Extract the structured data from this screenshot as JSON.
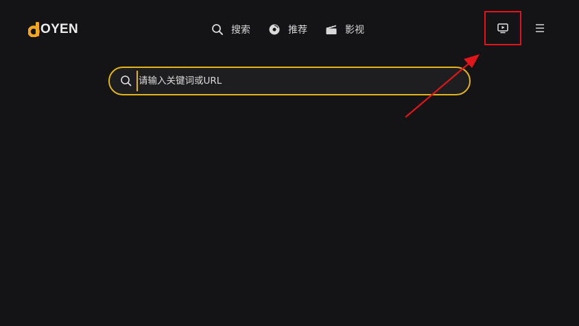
{
  "brand": {
    "logo_text": "OYEN",
    "logo_accent_color": "#f5a623"
  },
  "nav": {
    "items": [
      {
        "label": "搜索",
        "icon": "search-icon"
      },
      {
        "label": "推荐",
        "icon": "disc-icon"
      },
      {
        "label": "影视",
        "icon": "film-clapper-icon"
      }
    ]
  },
  "toolbar": {
    "tv_button_icon": "tv-play-icon",
    "menu_button_icon": "hamburger-menu-icon",
    "highlight_color": "#e1151a"
  },
  "search": {
    "placeholder": "请输入关键词或URL",
    "value": "",
    "border_color": "#e5b41a"
  },
  "colors": {
    "background": "#141416",
    "annotation_arrow": "#e1151a"
  }
}
